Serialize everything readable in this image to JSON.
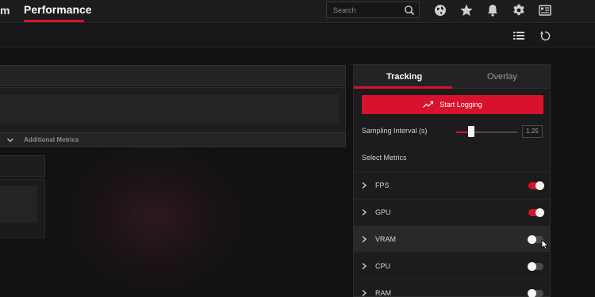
{
  "topbar": {
    "partial_tab": "m",
    "active_tab": "Performance",
    "search": {
      "placeholder": "Search"
    },
    "icons": [
      "search-icon",
      "globe-icon",
      "star-icon",
      "bell-icon",
      "gear-icon",
      "account-panel-icon"
    ]
  },
  "subbar": {
    "icons": [
      "list-view-icon",
      "reset-icon"
    ]
  },
  "left_panel": {
    "additional_metrics_label": "Additional Metrics"
  },
  "right_panel": {
    "tabs": [
      {
        "label": "Tracking",
        "active": true
      },
      {
        "label": "Overlay",
        "active": false
      }
    ],
    "start_logging_label": "Start Logging",
    "sampling_interval": {
      "label": "Sampling Interval (s)",
      "value": "1.25",
      "slider_fraction": 0.25
    },
    "select_metrics_label": "Select Metrics",
    "metrics": [
      {
        "label": "FPS",
        "enabled": true
      },
      {
        "label": "GPU",
        "enabled": true
      },
      {
        "label": "VRAM",
        "enabled": false
      },
      {
        "label": "CPU",
        "enabled": false
      },
      {
        "label": "RAM",
        "enabled": false
      }
    ]
  },
  "colors": {
    "accent": "#d8102a",
    "background": "#121213",
    "panel": "#1c1c1e"
  }
}
